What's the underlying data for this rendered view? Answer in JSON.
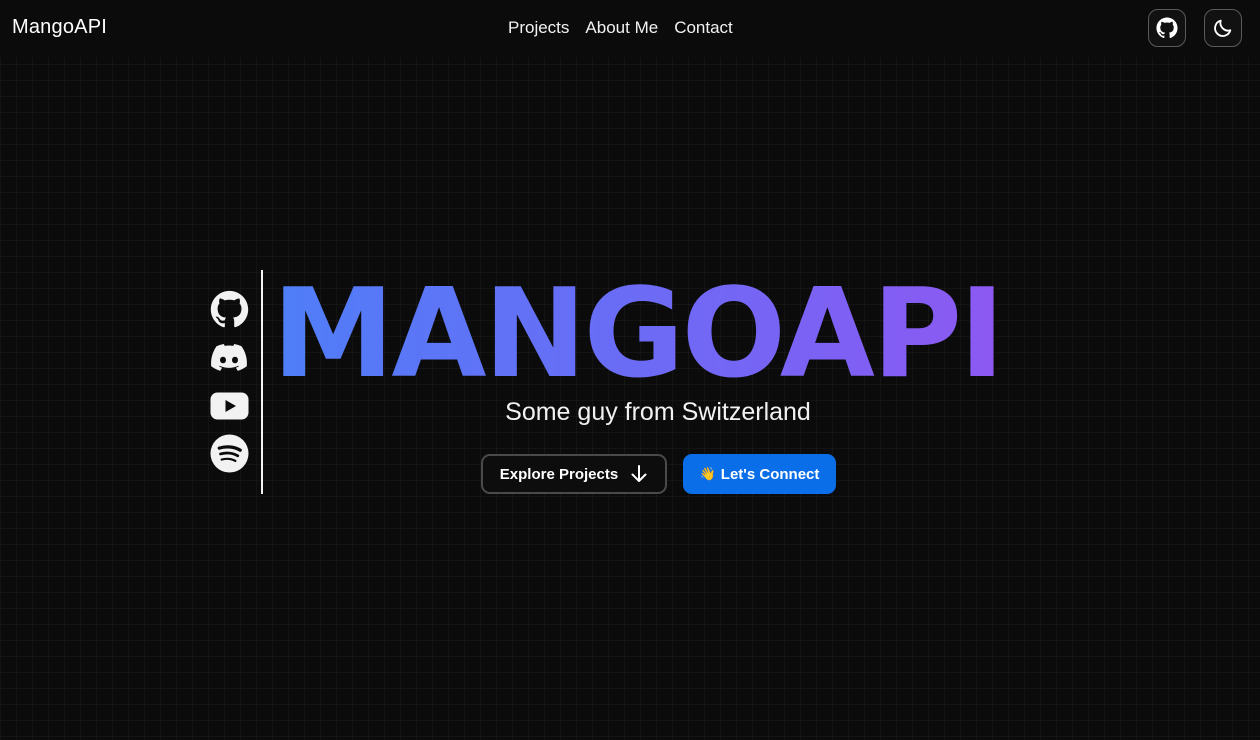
{
  "nav": {
    "brand": "MangoAPI",
    "links": [
      "Projects",
      "About Me",
      "Contact"
    ],
    "github_icon": "github-icon",
    "theme_icon": "moon-icon"
  },
  "socials": [
    "github-icon",
    "discord-icon",
    "youtube-icon",
    "spotify-icon"
  ],
  "hero": {
    "title": "MANGOAPI",
    "subtitle": "Some guy from Switzerland",
    "explore_label": "Explore Projects",
    "connect_emoji": "👋",
    "connect_label": "Let's Connect"
  },
  "colors": {
    "background": "#0b0b0b",
    "gradient_start": "#4f7ef8",
    "gradient_end": "#9156f2",
    "primary_button": "#0a6ee8"
  }
}
